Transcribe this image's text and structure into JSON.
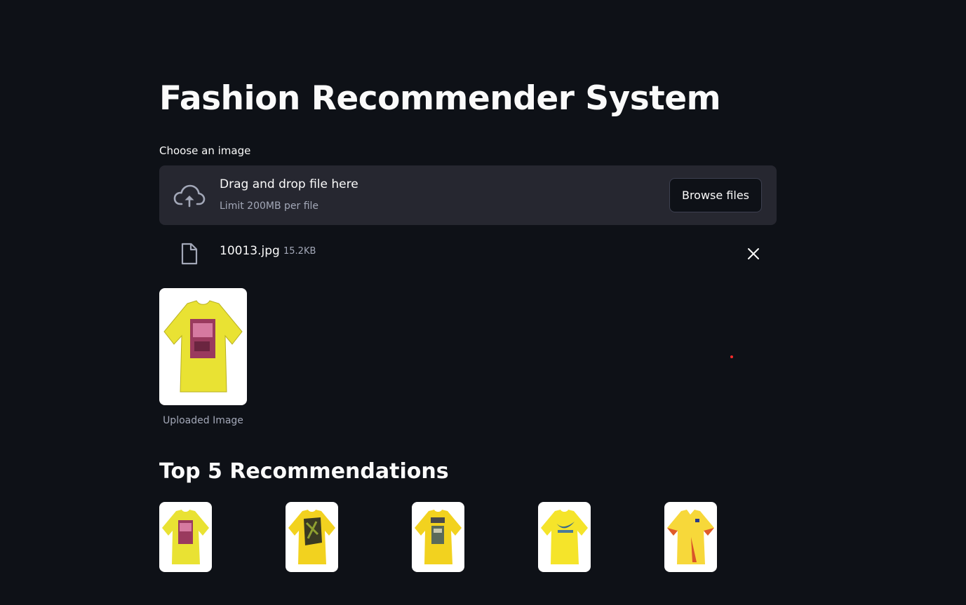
{
  "page": {
    "title": "Fashion Recommender System"
  },
  "uploader": {
    "label": "Choose an image",
    "drop_text": "Drag and drop file here",
    "limit_text": "Limit 200MB per file",
    "browse_label": "Browse files",
    "icon": "cloud-upload-icon"
  },
  "uploaded_file": {
    "name": "10013.jpg",
    "size": "15.2KB",
    "icon": "file-icon",
    "remove_icon": "close-icon"
  },
  "preview": {
    "caption": "Uploaded Image"
  },
  "recommendations": {
    "title": "Top 5 Recommendations",
    "items": [
      {
        "desc": "yellow t-shirt with pink graphic print"
      },
      {
        "desc": "yellow t-shirt with dark graphic print"
      },
      {
        "desc": "yellow t-shirt with text graphic"
      },
      {
        "desc": "yellow t-shirt with swoosh logo"
      },
      {
        "desc": "yellow polo jersey with red accents"
      }
    ]
  },
  "colors": {
    "background": "#0e1117",
    "surface": "#262730",
    "text": "#fafafa",
    "muted_text": "#a3a8b8",
    "shirt_yellow": "#f0e030"
  }
}
